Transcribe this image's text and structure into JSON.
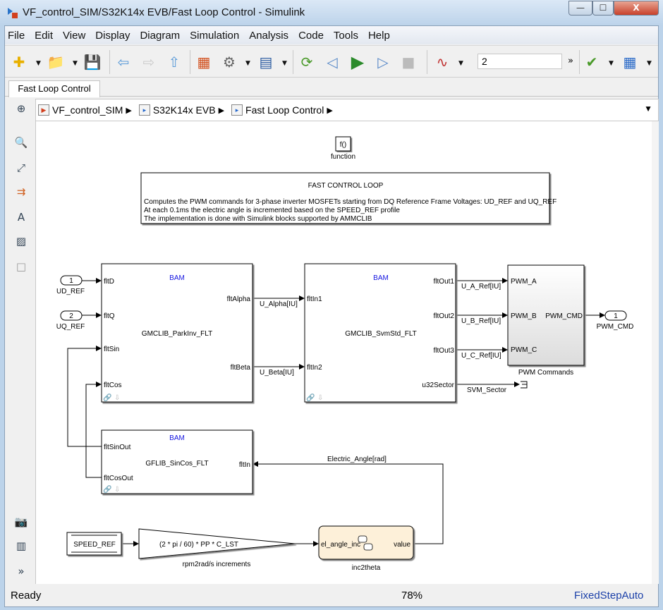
{
  "window": {
    "title": "VF_control_SIM/S32K14x EVB/Fast Loop Control - Simulink",
    "minimize": "—",
    "maximize": "☐",
    "close": "X"
  },
  "menu": [
    "File",
    "Edit",
    "View",
    "Display",
    "Diagram",
    "Simulation",
    "Analysis",
    "Code",
    "Tools",
    "Help"
  ],
  "toolbar": {
    "stop_time": "2",
    "overflow": "»"
  },
  "tabs": [
    {
      "label": "Fast Loop Control",
      "active": true
    }
  ],
  "breadcrumb": [
    "VF_control_SIM",
    "S32K14x EVB",
    "Fast Loop Control"
  ],
  "diagram": {
    "function_block": {
      "glyph": "f()",
      "label": "function"
    },
    "annotation": {
      "title": "FAST CONTROL LOOP",
      "lines": [
        "Computes the PWM commands for 3-phase inverter MOSFETs starting from DQ Reference Frame Voltages: UD_REF and UQ_REF",
        "At each 0.1ms the electric angle is incremented based on the SPEED_REF profile",
        "The implementation is done with Simulink blocks supported by AMMCLIB"
      ]
    },
    "inports": [
      {
        "num": "1",
        "name": "UD_REF"
      },
      {
        "num": "2",
        "name": "UQ_REF"
      }
    ],
    "outport": {
      "num": "1",
      "name": "PWM_CMD"
    },
    "park_inv": {
      "mask": "BAM",
      "name": "GMCLIB_ParkInv_FLT",
      "inputs": [
        "fltD",
        "fltQ",
        "fltSin",
        "fltCos"
      ],
      "outputs": [
        "fltAlpha",
        "fltBeta"
      ]
    },
    "svm": {
      "mask": "BAM",
      "name": "GMCLIB_SvmStd_FLT",
      "inputs": [
        "fltIn1",
        "fltIn2"
      ],
      "outputs": [
        "fltOut1",
        "fltOut2",
        "fltOut3",
        "u32Sector"
      ]
    },
    "pwm": {
      "name": "PWM Commands",
      "inputs": [
        "PWM_A",
        "PWM_B",
        "PWM_C"
      ],
      "output": "PWM_CMD"
    },
    "sincos": {
      "mask": "BAM",
      "name": "GFLIB_SinCos_FLT",
      "outputs": [
        "fltSinOut",
        "fltCosOut"
      ],
      "input": "fltIn"
    },
    "signals": {
      "alpha": "U_Alpha[IU]",
      "beta": "U_Beta[IU]",
      "a": "U_A_Ref[IU]",
      "b": "U_B_Ref[IU]",
      "c": "U_C_Ref[IU]",
      "sector": "SVM_Sector",
      "angle": "Electric_Angle[rad]"
    },
    "speed_ref": "SPEED_REF",
    "gain": {
      "expr": "(2 * pi / 60) * PP * C_LST",
      "name": "rpm2rad/s increments"
    },
    "chart": {
      "name": "inc2theta",
      "input": "el_angle_inc",
      "output": "value",
      "color": "#fdf0d9"
    }
  },
  "status": {
    "state": "Ready",
    "zoom": "78%",
    "solver": "FixedStepAuto",
    "solver_color": "#1a3fa8"
  }
}
